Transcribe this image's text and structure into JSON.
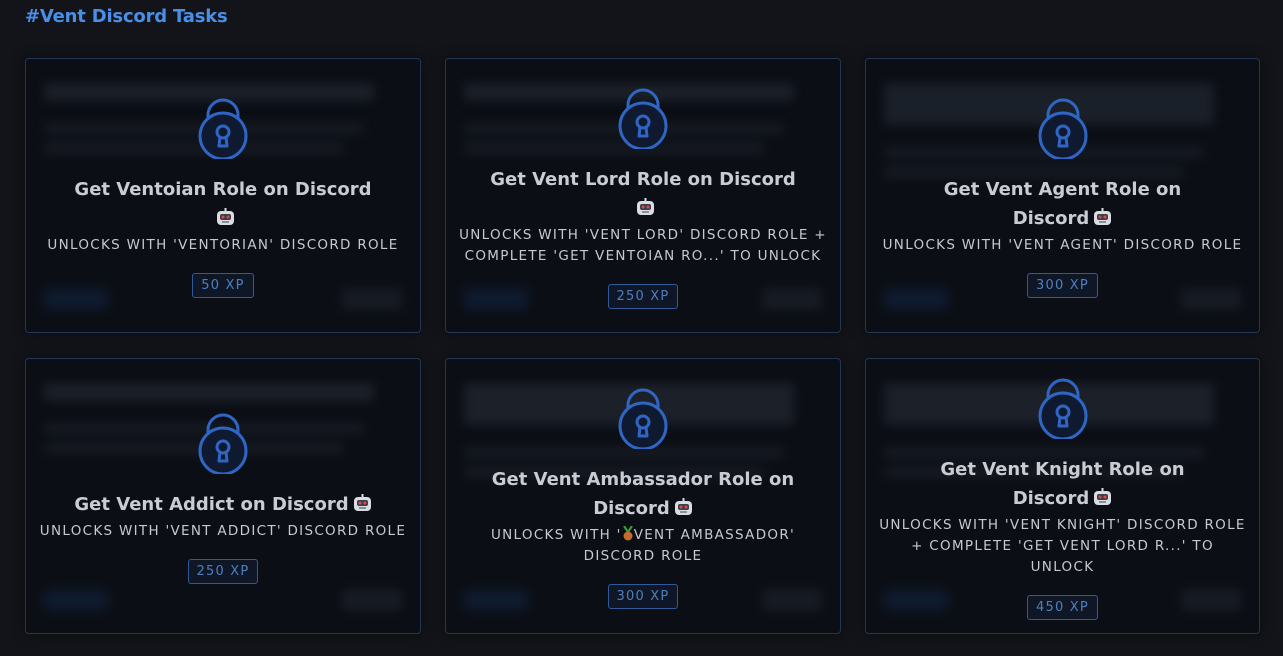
{
  "section": {
    "title": "#Vent Discord Tasks"
  },
  "colors": {
    "accent": "#4a8fe7",
    "card_border": "#243656",
    "lock": "#2f66c4"
  },
  "cards": [
    {
      "title": "Get Ventoian Role on Discord",
      "unlock": "UNLOCKS WITH 'VENTORIAN' DISCORD ROLE",
      "xp": "50 XP",
      "icon": "robot-icon"
    },
    {
      "title": "Get Vent Lord Role on Discord",
      "unlock": "UNLOCKS WITH 'VENT LORD' DISCORD ROLE + COMPLETE 'GET VENTOIAN RO...' TO UNLOCK",
      "xp": "250 XP",
      "icon": "robot-icon"
    },
    {
      "title": "Get Vent Agent Role on Discord",
      "unlock": "UNLOCKS WITH 'VENT AGENT' DISCORD ROLE",
      "xp": "300 XP",
      "icon": "robot-icon"
    },
    {
      "title": "Get Vent Addict on Discord",
      "unlock": "UNLOCKS WITH 'VENT ADDICT' DISCORD ROLE",
      "xp": "250 XP",
      "icon": "robot-icon"
    },
    {
      "title": "Get Vent Ambassador Role on Discord",
      "unlock_pre": "UNLOCKS WITH '",
      "unlock_post": "VENT AMBASSADOR' DISCORD ROLE",
      "xp": "300 XP",
      "icon": "robot-icon"
    },
    {
      "title": "Get Vent Knight Role on Discord",
      "unlock": "UNLOCKS WITH 'VENT KNIGHT' DISCORD ROLE + COMPLETE 'GET VENT LORD R...' TO UNLOCK",
      "xp": "450 XP",
      "icon": "robot-icon"
    }
  ]
}
